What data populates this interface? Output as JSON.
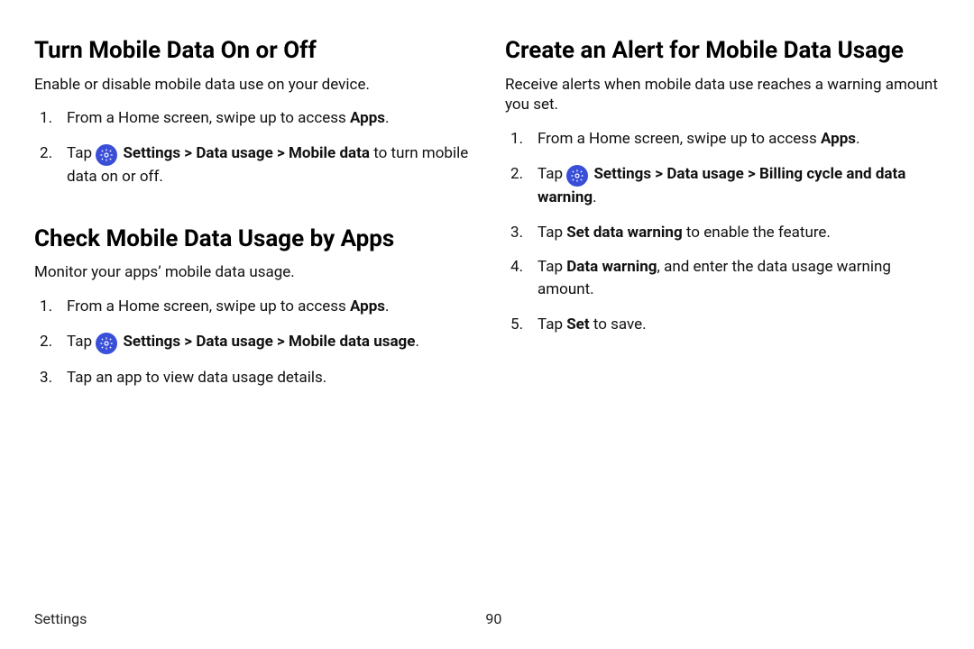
{
  "left": {
    "section1": {
      "heading": "Turn Mobile Data On or Off",
      "intro": "Enable or disable mobile data use on your device.",
      "step1_a": "From a Home screen, swipe up to access ",
      "step1_b": "Apps",
      "step1_c": ".",
      "step2_a": "Tap ",
      "step2_b": "Settings",
      "step2_chev1": " > ",
      "step2_c": "Data usage",
      "step2_chev2": " > ",
      "step2_d": "Mobile data",
      "step2_e": " to turn mobile data on or off."
    },
    "section2": {
      "heading": "Check Mobile Data Usage by Apps",
      "intro": "Monitor your apps’ mobile data usage.",
      "step1_a": "From a Home screen, swipe up to access ",
      "step1_b": "Apps",
      "step1_c": ".",
      "step2_a": "Tap ",
      "step2_b": "Settings",
      "step2_chev1": " > ",
      "step2_c": "Data usage",
      "step2_chev2": " > ",
      "step2_d": "Mobile data usage",
      "step2_e": ".",
      "step3": "Tap an app to view data usage details."
    }
  },
  "right": {
    "section1": {
      "heading": "Create an Alert for Mobile Data Usage",
      "intro": "Receive alerts when mobile data use reaches a warning amount you set.",
      "step1_a": "From a Home screen, swipe up to access ",
      "step1_b": "Apps",
      "step1_c": ".",
      "step2_a": "Tap ",
      "step2_b": "Settings",
      "step2_chev1": " > ",
      "step2_c": "Data usage",
      "step2_chev2": " > ",
      "step2_d": "Billing cycle and data warning",
      "step2_e": ".",
      "step3_a": "Tap ",
      "step3_b": "Set data warning",
      "step3_c": " to enable the feature.",
      "step4_a": "Tap ",
      "step4_b": "Data warning",
      "step4_c": ", and enter the data usage warning amount.",
      "step5_a": "Tap ",
      "step5_b": "Set",
      "step5_c": " to save."
    }
  },
  "footer": {
    "label": "Settings",
    "page": "90"
  }
}
